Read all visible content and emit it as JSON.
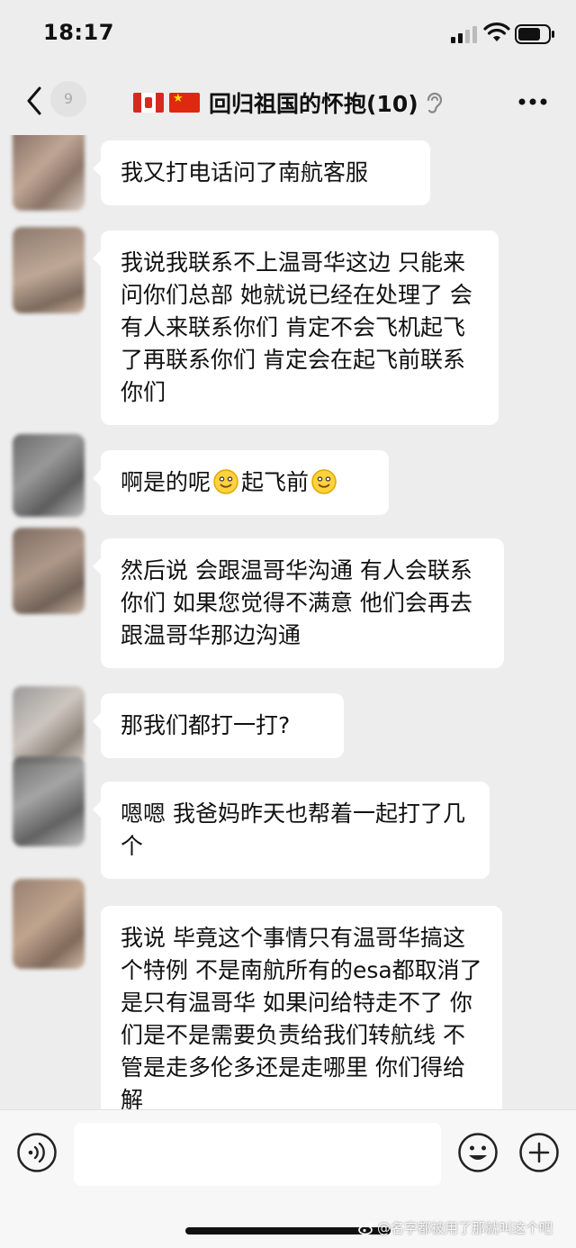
{
  "status_bar": {
    "time": "18:17"
  },
  "header": {
    "unread_count": "9",
    "title": "回归祖国的怀抱(10)",
    "flags": [
      "canada-flag",
      "china-flag"
    ]
  },
  "messages": [
    {
      "text": "我又打电话问了南航客服"
    },
    {
      "text": "我说我联系不上温哥华这边 只能来问你们总部  她就说已经在处理了 会有人来联系你们 肯定不会飞机起飞了再联系你们 肯定会在起飞前联系你们"
    },
    {
      "text_parts": [
        "啊是的呢",
        "起飞前"
      ],
      "emoji": "smiling-face-icon"
    },
    {
      "text": "然后说  会跟温哥华沟通 有人会联系你们 如果您觉得不满意 他们会再去跟温哥华那边沟通"
    },
    {
      "text": "那我们都打一打?"
    },
    {
      "text": "嗯嗯 我爸妈昨天也帮着一起打了几个"
    },
    {
      "text": "我说 毕竟这个事情只有温哥华搞这个特例 不是南航所有的esa都取消了 是只有温哥华  如果问给特走不了 你们是不是需要负责给我们转航线 不管是走多伦多还是走哪里 你们得给解"
    }
  ],
  "input_bar": {
    "placeholder": ""
  },
  "watermark": "@名字都被用了那就叫这个吧",
  "colors": {
    "background": "#ededed",
    "bubble": "#ffffff",
    "input_bar": "#f7f7f7"
  }
}
